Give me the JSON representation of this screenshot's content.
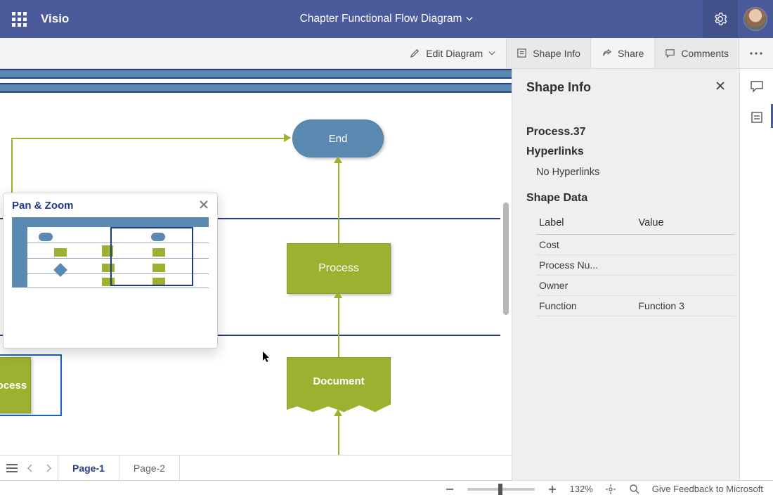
{
  "titlebar": {
    "app_name": "Visio",
    "doc_title": "Chapter Functional Flow Diagram"
  },
  "toolbar": {
    "edit": "Edit Diagram",
    "shape_info": "Shape Info",
    "share": "Share",
    "comments": "Comments"
  },
  "canvas": {
    "end_label": "End",
    "process_label": "Process",
    "document_label": "Document",
    "edge_label": "rocess"
  },
  "panzoom": {
    "title": "Pan & Zoom"
  },
  "pages": {
    "tabs": [
      "Page-1",
      "Page-2"
    ],
    "active_index": 0
  },
  "shape_info": {
    "pane_title": "Shape Info",
    "shape_name": "Process.37",
    "hyperlinks_heading": "Hyperlinks",
    "hyperlinks_empty": "No Hyperlinks",
    "shape_data_heading": "Shape Data",
    "table": {
      "header_label": "Label",
      "header_value": "Value",
      "rows": [
        {
          "label": "Cost",
          "value": ""
        },
        {
          "label": "Process Nu...",
          "value": ""
        },
        {
          "label": "Owner",
          "value": ""
        },
        {
          "label": "Function",
          "value": "Function 3"
        }
      ]
    }
  },
  "status": {
    "zoom_percent": "132%",
    "feedback": "Give Feedback to Microsoft"
  }
}
